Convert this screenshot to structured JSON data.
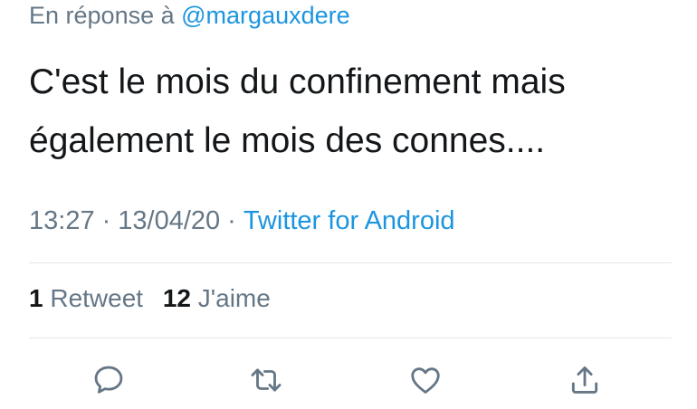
{
  "reply": {
    "prefix": "En réponse à",
    "mention": "@margauxdere"
  },
  "tweet": {
    "line1": "C'est le mois du confinement mais",
    "line2": "également le mois des connes...."
  },
  "meta": {
    "time": "13:27",
    "separator": "·",
    "date": "13/04/20",
    "source": "Twitter for Android"
  },
  "stats": {
    "retweet_count": "1",
    "retweet_label": "Retweet",
    "like_count": "12",
    "like_label": "J'aime"
  },
  "actions": {
    "reply_icon": "comment-icon",
    "retweet_icon": "retweet-icon",
    "like_icon": "heart-icon",
    "share_icon": "share-icon"
  },
  "colors": {
    "text": "#14171a",
    "secondary": "#657786",
    "link": "#1b95e0",
    "divider": "#e1e8ed"
  }
}
